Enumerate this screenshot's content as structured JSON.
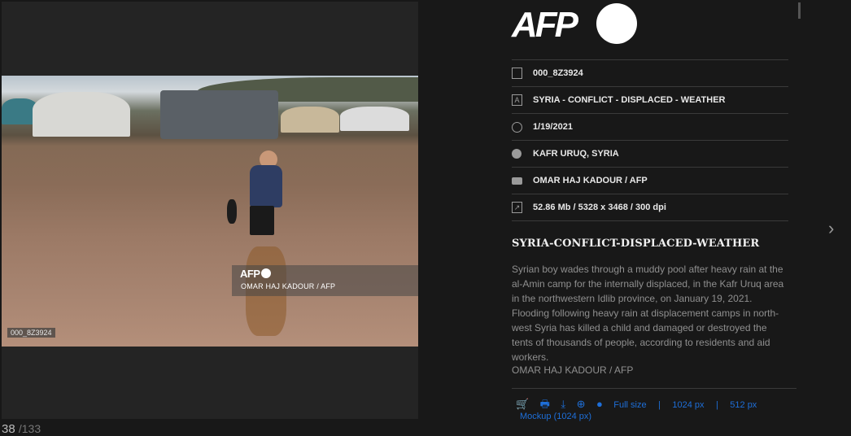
{
  "photo": {
    "watermark_logo": "AFP",
    "watermark_credit": "OMAR HAJ KADOUR / AFP",
    "id_badge": "000_8Z3924"
  },
  "counter": {
    "current": "38",
    "total": "/133"
  },
  "brand": {
    "logo": "AFP",
    "logo_color": "#ffffff"
  },
  "meta": {
    "id": "000_8Z3924",
    "keywords": "SYRIA - CONFLICT - DISPLACED - WEATHER",
    "date": "1/19/2021",
    "location": "KAFR URUQ, SYRIA",
    "credit": "OMAR HAJ KADOUR / AFP",
    "file_info": "52.86 Mb / 5328 x 3468 / 300 dpi"
  },
  "headline": "SYRIA-CONFLICT-DISPLACED-WEATHER",
  "caption": "Syrian boy wades through a muddy pool after heavy rain at the al-Amin camp for the internally displaced, in the Kafr Uruq area in the northwestern Idlib province, on January 19, 2021. Flooding following heavy rain at displacement camps in north-west Syria has killed a child and damaged or destroyed the tents of thousands of people, according to residents and aid workers.",
  "caption_credit": "OMAR HAJ KADOUR / AFP",
  "actions": {
    "full_size": "Full size",
    "px1024": "1024 px",
    "px512": "512 px",
    "mockup": "Mockup (1024 px)",
    "link_color": "#1e6fd9"
  },
  "icons": [
    "document-icon",
    "text-icon",
    "clock-icon",
    "globe-icon",
    "camera-icon",
    "resize-icon",
    "cart-icon",
    "print-icon",
    "download-icon",
    "zoom-icon",
    "web-icon",
    "chevron-right-icon"
  ]
}
